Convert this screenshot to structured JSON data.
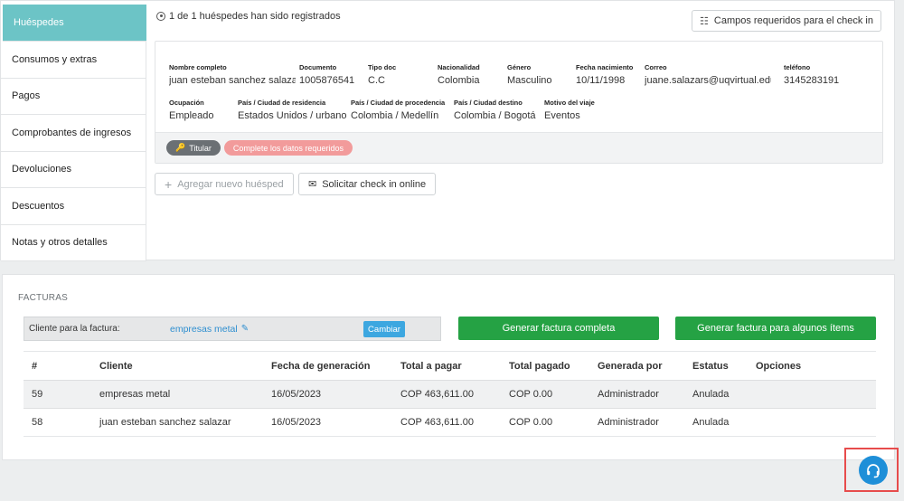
{
  "sidebar": {
    "items": [
      {
        "label": "Huéspedes",
        "active": true
      },
      {
        "label": "Consumos y extras"
      },
      {
        "label": "Pagos"
      },
      {
        "label": "Comprobantes de ingresos"
      },
      {
        "label": "Devoluciones"
      },
      {
        "label": "Descuentos"
      },
      {
        "label": "Notas y otros detalles"
      }
    ]
  },
  "guests": {
    "count_text": "1 de 1 huéspedes han sido registrados",
    "required_fields_button": "Campos requeridos para el check in",
    "guest": {
      "fields": [
        {
          "label": "Nombre completo",
          "value": "juan esteban sanchez salazar"
        },
        {
          "label": "Documento",
          "value": "1005876541"
        },
        {
          "label": "Tipo doc",
          "value": "C.C"
        },
        {
          "label": "Nacionalidad",
          "value": "Colombia"
        },
        {
          "label": "Género",
          "value": "Masculino"
        },
        {
          "label": "Fecha nacimiento",
          "value": "10/11/1998"
        },
        {
          "label": "Correo",
          "value": "juane.salazars@uqvirtual.edu.co"
        },
        {
          "label": "teléfono",
          "value": "3145283191"
        },
        {
          "label": "Ocupación",
          "value": "Empleado"
        },
        {
          "label": "País / Ciudad de residencia",
          "value": "Estados Unidos / urbano"
        },
        {
          "label": "País / Ciudad de procedencia",
          "value": "Colombia / Medellín"
        },
        {
          "label": "País / Ciudad destino",
          "value": "Colombia / Bogotá"
        },
        {
          "label": "Motivo del viaje",
          "value": "Eventos"
        }
      ],
      "badge_titular": "Titular",
      "badge_warning": "Complete los datos requeridos"
    },
    "add_guest_button": "Agregar nuevo huésped",
    "online_checkin_button": "Solicitar check in online"
  },
  "invoices": {
    "title": "FACTURAS",
    "client_label": "Cliente para la factura:",
    "client_value": "empresas metal",
    "change_button": "Cambiar",
    "generate_full_button": "Generar factura completa",
    "generate_some_button": "Generar factura para algunos ítems",
    "columns": [
      "#",
      "Cliente",
      "Fecha de generación",
      "Total a pagar",
      "Total pagado",
      "Generada por",
      "Estatus",
      "Opciones"
    ],
    "rows": [
      {
        "id": "59",
        "client": "empresas metal",
        "date": "16/05/2023",
        "total": "COP 463,611.00",
        "paid": "COP 0.00",
        "by": "Administrador",
        "status": "Anulada",
        "options": ""
      },
      {
        "id": "58",
        "client": "juan esteban sanchez salazar",
        "date": "16/05/2023",
        "total": "COP 463,611.00",
        "paid": "COP 0.00",
        "by": "Administrador",
        "status": "Anulada",
        "options": ""
      }
    ]
  },
  "icons": {
    "user": "user-circle-icon",
    "list": "list-icon",
    "key": "key-icon",
    "plus": "plus-icon",
    "mail": "mail-icon",
    "edit": "edit-icon",
    "support": "headset-icon"
  },
  "colors": {
    "sidebar_active": "#6cc4c6",
    "primary_green": "#25a244",
    "link_blue": "#2f8fd0",
    "warning_pill": "#f29b9b",
    "support_blue": "#1e8fd8"
  }
}
